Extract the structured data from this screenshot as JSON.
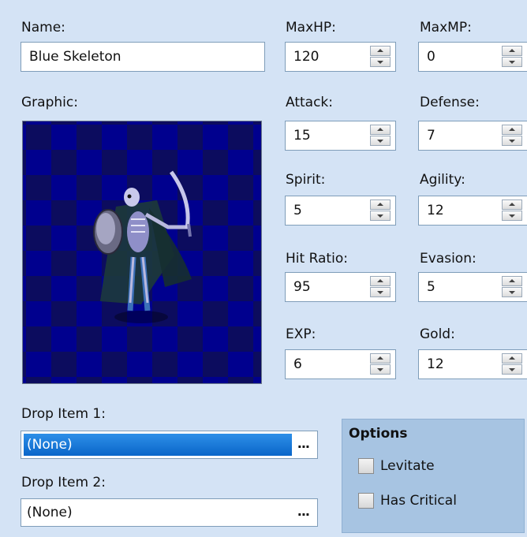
{
  "name": {
    "label": "Name:",
    "value": "Blue Skeleton"
  },
  "graphic": {
    "label": "Graphic:"
  },
  "stats": [
    {
      "label": "MaxHP:",
      "value": "120"
    },
    {
      "label": "MaxMP:",
      "value": "0"
    },
    {
      "label": "Attack:",
      "value": "15"
    },
    {
      "label": "Defense:",
      "value": "7"
    },
    {
      "label": "Spirit:",
      "value": "5"
    },
    {
      "label": "Agility:",
      "value": "12"
    },
    {
      "label": "Hit Ratio:",
      "value": "95"
    },
    {
      "label": "Evasion:",
      "value": "5"
    },
    {
      "label": "EXP:",
      "value": "6"
    },
    {
      "label": "Gold:",
      "value": "12"
    }
  ],
  "drops": [
    {
      "label": "Drop Item 1:",
      "value": "(None)",
      "button": "..."
    },
    {
      "label": "Drop Item 2:",
      "value": "(None)",
      "button": "..."
    }
  ],
  "options": {
    "title": "Options",
    "items": [
      {
        "label": "Levitate",
        "checked": false
      },
      {
        "label": "Has Critical",
        "checked": false
      }
    ]
  },
  "colors": {
    "background": "#d4e3f5",
    "options_panel": "#a7c4e2",
    "selection": "#0a66c9",
    "graphic_dark": "#0c0c5e",
    "graphic_light": "#00008e"
  }
}
